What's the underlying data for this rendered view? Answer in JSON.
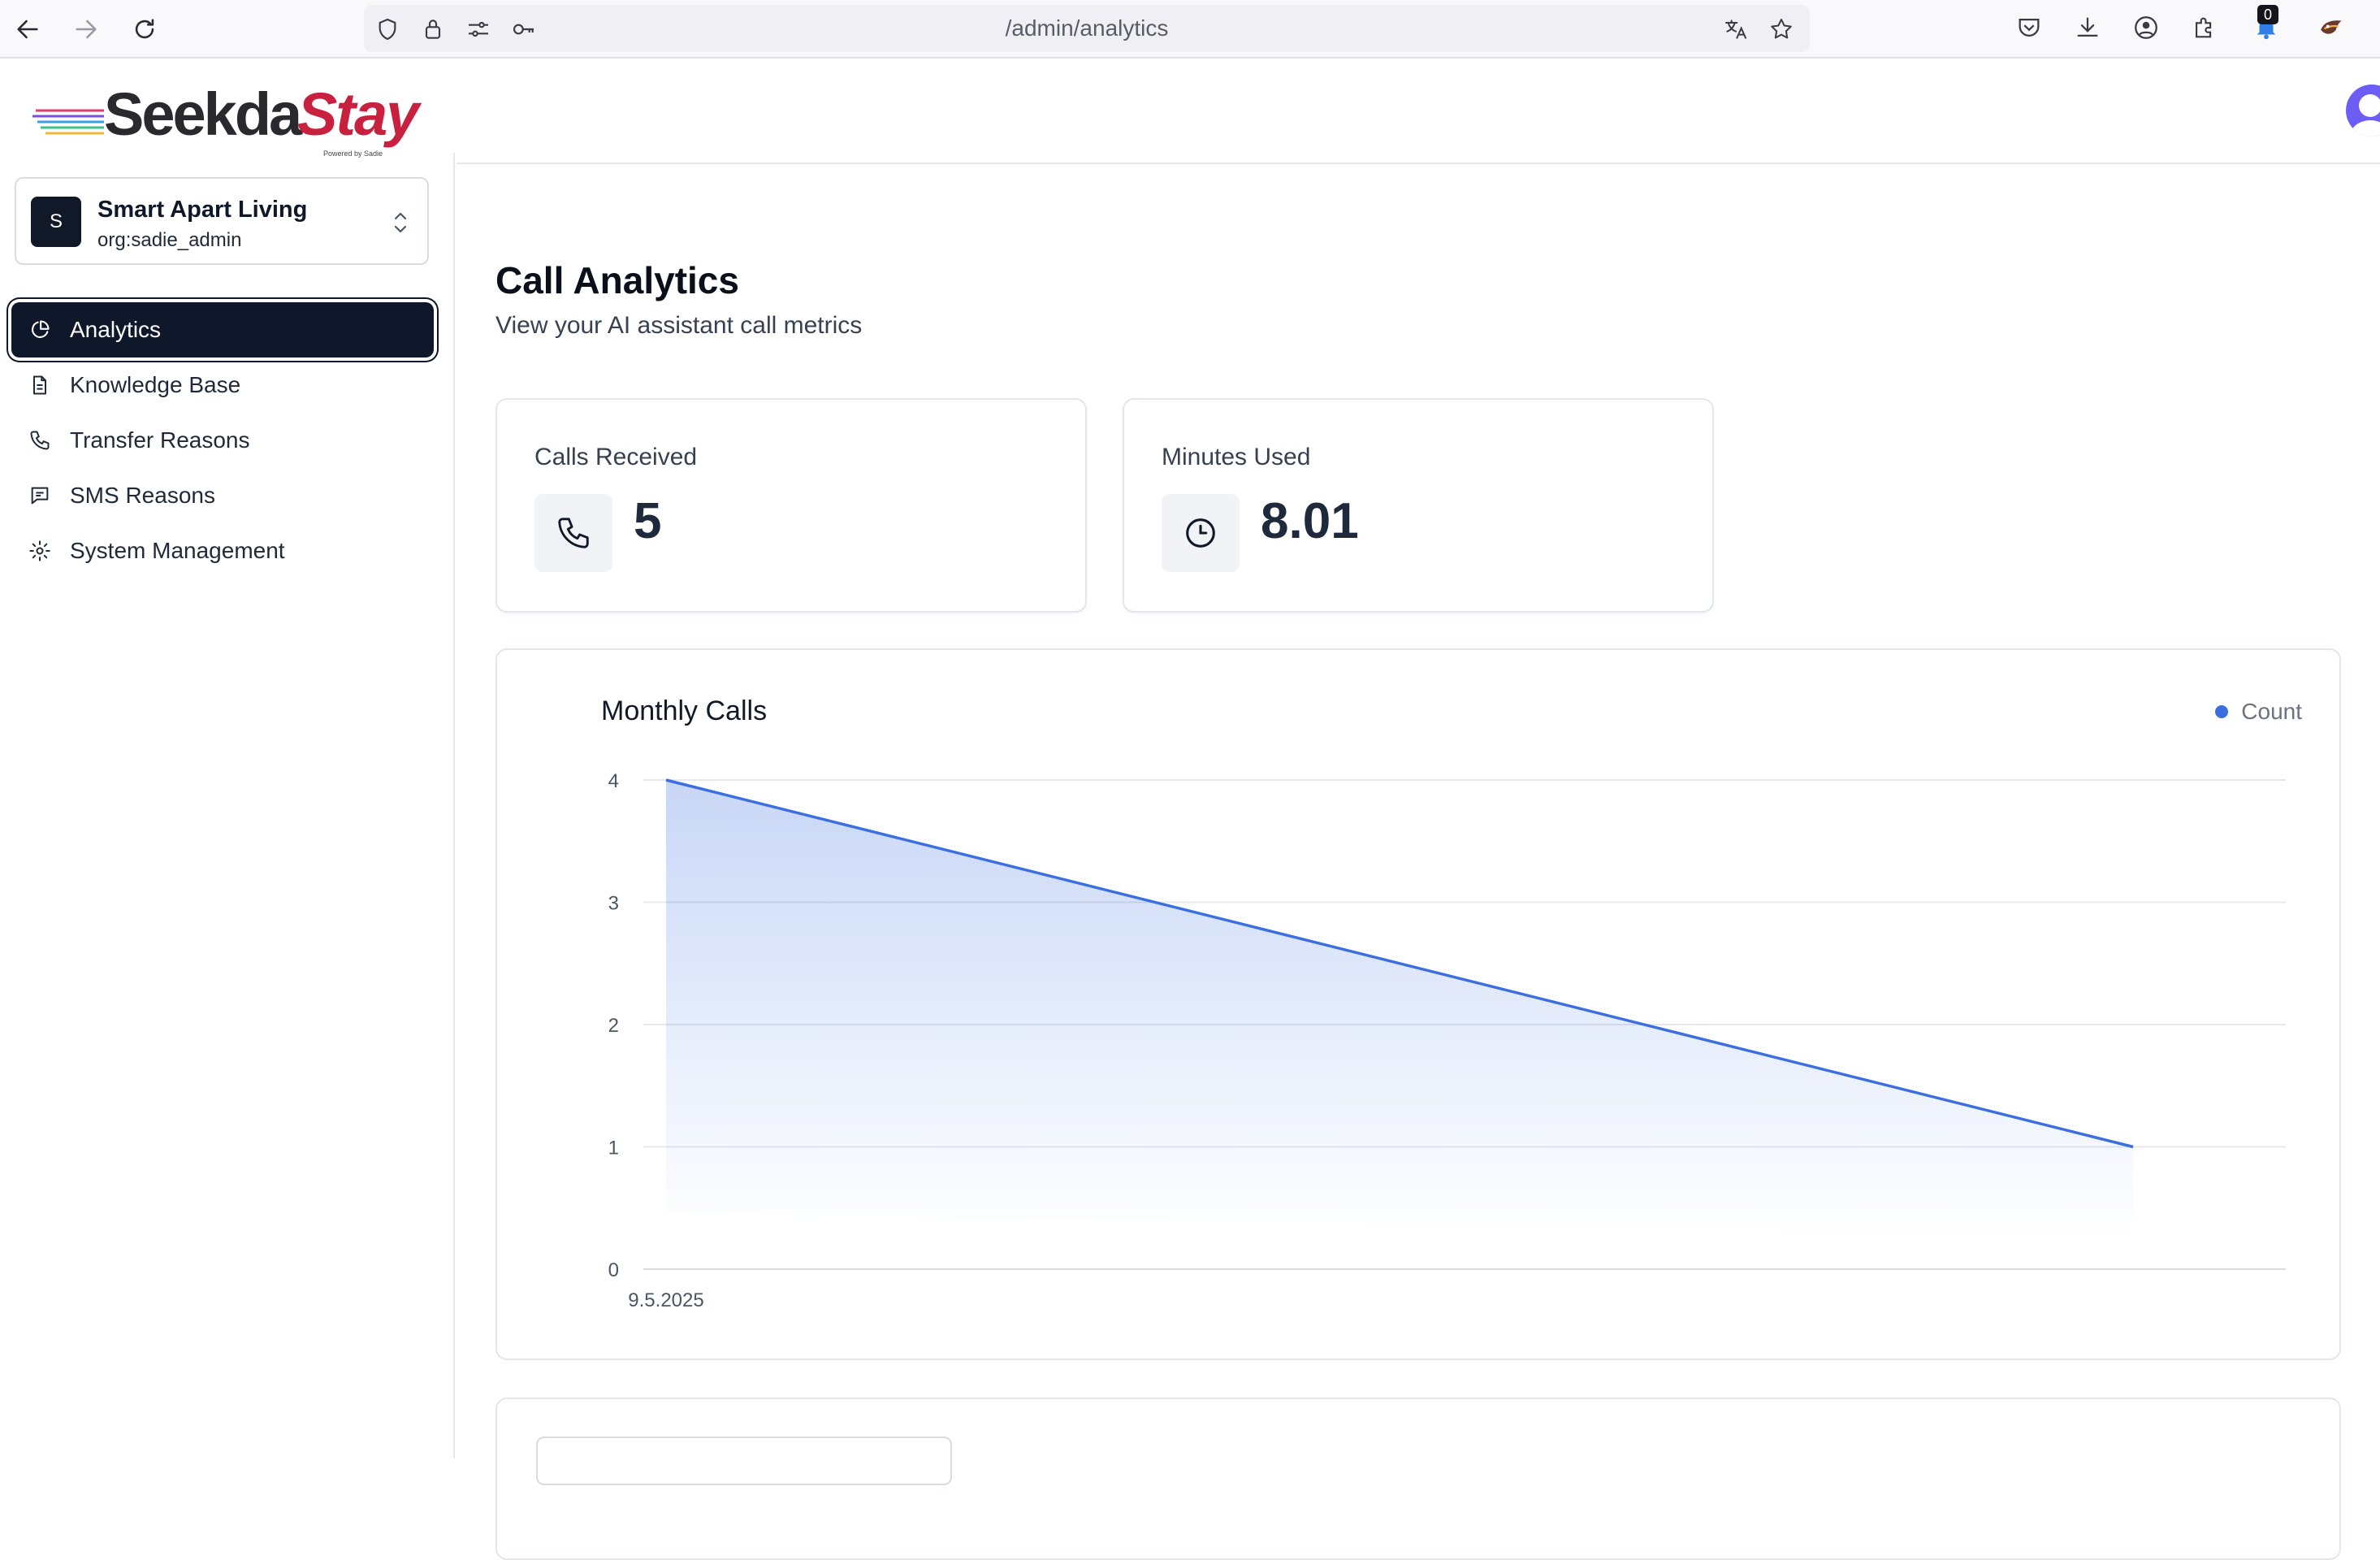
{
  "browser": {
    "url": "/admin/analytics",
    "notification_count": "0"
  },
  "brand": {
    "name_part1": "Seekda",
    "name_part2": "Stay",
    "tagline": "Powered by Sadie"
  },
  "org": {
    "initial": "S",
    "name": "Smart Apart Living",
    "role": "org:sadie_admin"
  },
  "sidebar": {
    "items": [
      {
        "label": "Analytics",
        "icon": "pie-chart-icon",
        "active": true
      },
      {
        "label": "Knowledge Base",
        "icon": "document-icon",
        "active": false
      },
      {
        "label": "Transfer Reasons",
        "icon": "phone-icon",
        "active": false
      },
      {
        "label": "SMS Reasons",
        "icon": "message-icon",
        "active": false
      },
      {
        "label": "System Management",
        "icon": "gear-icon",
        "active": false
      }
    ]
  },
  "main": {
    "title": "Call Analytics",
    "subtitle": "View your AI assistant call metrics",
    "stats": [
      {
        "label": "Calls Received",
        "value": "5",
        "icon": "phone-icon"
      },
      {
        "label": "Minutes Used",
        "value": "8.01",
        "icon": "clock-icon"
      }
    ]
  },
  "chart_data": {
    "type": "area",
    "title": "Monthly Calls",
    "x_tick_labels": [
      "9.5.2025"
    ],
    "series": [
      {
        "name": "Count",
        "values": [
          4,
          1
        ],
        "color": "#3b6fe0"
      }
    ],
    "yticks": [
      0,
      1,
      2,
      3,
      4
    ],
    "ylim": [
      0,
      4
    ],
    "grid": true,
    "legend_position": "top-right"
  }
}
